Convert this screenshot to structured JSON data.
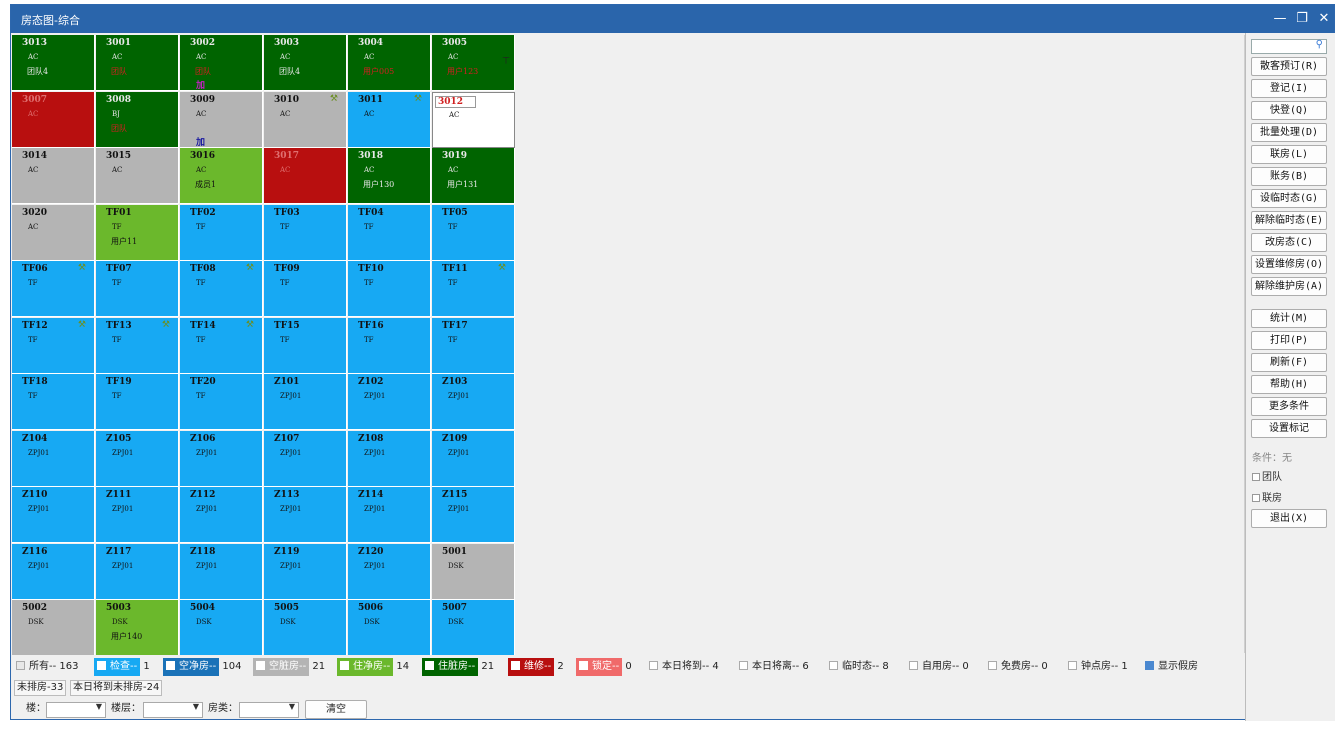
{
  "window": {
    "title": "房态图-综合",
    "minimize": "—",
    "restore": "❐",
    "close": "✕"
  },
  "colors": {
    "empty": "#17a9f3",
    "dirty": "#b4b4b4",
    "occ_clean": "#6bb82c",
    "occ_dirty": "#006400",
    "repair": "#b80f0f",
    "locked": "#f06a6a",
    "titlebar": "#2a65ab"
  },
  "rooms": [
    {
      "num": "3013",
      "type": "AC",
      "guest": "团队4",
      "status": "occ-dirty"
    },
    {
      "num": "3001",
      "type": "AC",
      "guest": "团队",
      "status": "occ-dirty",
      "red": true
    },
    {
      "num": "3002",
      "type": "AC",
      "guest": "团队",
      "status": "occ-dirty",
      "red": true,
      "mark": "加",
      "markColor": "#c020c0"
    },
    {
      "num": "3003",
      "type": "AC",
      "guest": "团队4",
      "status": "occ-dirty"
    },
    {
      "num": "3004",
      "type": "AC",
      "guest": "用户005",
      "status": "occ-dirty",
      "red": true
    },
    {
      "num": "3005",
      "type": "AC",
      "guest": "用户123",
      "status": "occ-dirty",
      "red": true,
      "ext": "ㄒ"
    },
    {
      "num": "3007",
      "type": "AC",
      "guest": "",
      "status": "repair"
    },
    {
      "num": "3008",
      "type": "BJ",
      "guest": "团队",
      "status": "occ-dirty",
      "red": true
    },
    {
      "num": "3009",
      "type": "AC",
      "guest": "",
      "status": "dirty",
      "mark": "加",
      "markColor": "#1a1aa0"
    },
    {
      "num": "3010",
      "type": "AC",
      "guest": "",
      "status": "dirty",
      "tool": true
    },
    {
      "num": "3011",
      "type": "AC",
      "guest": "",
      "status": "empty",
      "tool": true
    },
    {
      "num": "3012",
      "type": "AC",
      "guest": "",
      "status": "white"
    },
    {
      "num": "3014",
      "type": "AC",
      "guest": "",
      "status": "dirty"
    },
    {
      "num": "3015",
      "type": "AC",
      "guest": "",
      "status": "dirty"
    },
    {
      "num": "3016",
      "type": "AC",
      "guest": "成员1",
      "status": "occ-clean"
    },
    {
      "num": "3017",
      "type": "AC",
      "guest": "",
      "status": "repair"
    },
    {
      "num": "3018",
      "type": "AC",
      "guest": "用户130",
      "status": "occ-dirty"
    },
    {
      "num": "3019",
      "type": "AC",
      "guest": "用户131",
      "status": "occ-dirty"
    },
    {
      "num": "3020",
      "type": "AC",
      "guest": "",
      "status": "dirty"
    },
    {
      "num": "TF01",
      "type": "TF",
      "guest": "用户11",
      "status": "occ-clean"
    },
    {
      "num": "TF02",
      "type": "TF",
      "guest": "",
      "status": "empty"
    },
    {
      "num": "TF03",
      "type": "TF",
      "guest": "",
      "status": "empty"
    },
    {
      "num": "TF04",
      "type": "TF",
      "guest": "",
      "status": "empty"
    },
    {
      "num": "TF05",
      "type": "TF",
      "guest": "",
      "status": "empty"
    },
    {
      "num": "TF06",
      "type": "TF",
      "guest": "",
      "status": "empty",
      "tool": true
    },
    {
      "num": "TF07",
      "type": "TF",
      "guest": "",
      "status": "empty"
    },
    {
      "num": "TF08",
      "type": "TF",
      "guest": "",
      "status": "empty",
      "tool": true
    },
    {
      "num": "TF09",
      "type": "TF",
      "guest": "",
      "status": "empty"
    },
    {
      "num": "TF10",
      "type": "TF",
      "guest": "",
      "status": "empty"
    },
    {
      "num": "TF11",
      "type": "TF",
      "guest": "",
      "status": "empty",
      "tool": true
    },
    {
      "num": "TF12",
      "type": "TF",
      "guest": "",
      "status": "empty",
      "tool": true
    },
    {
      "num": "TF13",
      "type": "TF",
      "guest": "",
      "status": "empty",
      "tool": true
    },
    {
      "num": "TF14",
      "type": "TF",
      "guest": "",
      "status": "empty",
      "tool": true
    },
    {
      "num": "TF15",
      "type": "TF",
      "guest": "",
      "status": "empty"
    },
    {
      "num": "TF16",
      "type": "TF",
      "guest": "",
      "status": "empty"
    },
    {
      "num": "TF17",
      "type": "TF",
      "guest": "",
      "status": "empty"
    },
    {
      "num": "TF18",
      "type": "TF",
      "guest": "",
      "status": "empty"
    },
    {
      "num": "TF19",
      "type": "TF",
      "guest": "",
      "status": "empty"
    },
    {
      "num": "TF20",
      "type": "TF",
      "guest": "",
      "status": "empty"
    },
    {
      "num": "Z101",
      "type": "ZPJ01",
      "guest": "",
      "status": "empty"
    },
    {
      "num": "Z102",
      "type": "ZPJ01",
      "guest": "",
      "status": "empty"
    },
    {
      "num": "Z103",
      "type": "ZPJ01",
      "guest": "",
      "status": "empty"
    },
    {
      "num": "Z104",
      "type": "ZPJ01",
      "guest": "",
      "status": "empty"
    },
    {
      "num": "Z105",
      "type": "ZPJ01",
      "guest": "",
      "status": "empty"
    },
    {
      "num": "Z106",
      "type": "ZPJ01",
      "guest": "",
      "status": "empty"
    },
    {
      "num": "Z107",
      "type": "ZPJ01",
      "guest": "",
      "status": "empty"
    },
    {
      "num": "Z108",
      "type": "ZPJ01",
      "guest": "",
      "status": "empty"
    },
    {
      "num": "Z109",
      "type": "ZPJ01",
      "guest": "",
      "status": "empty"
    },
    {
      "num": "Z110",
      "type": "ZPJ01",
      "guest": "",
      "status": "empty"
    },
    {
      "num": "Z111",
      "type": "ZPJ01",
      "guest": "",
      "status": "empty"
    },
    {
      "num": "Z112",
      "type": "ZPJ01",
      "guest": "",
      "status": "empty"
    },
    {
      "num": "Z113",
      "type": "ZPJ01",
      "guest": "",
      "status": "empty"
    },
    {
      "num": "Z114",
      "type": "ZPJ01",
      "guest": "",
      "status": "empty"
    },
    {
      "num": "Z115",
      "type": "ZPJ01",
      "guest": "",
      "status": "empty"
    },
    {
      "num": "Z116",
      "type": "ZPJ01",
      "guest": "",
      "status": "empty"
    },
    {
      "num": "Z117",
      "type": "ZPJ01",
      "guest": "",
      "status": "empty"
    },
    {
      "num": "Z118",
      "type": "ZPJ01",
      "guest": "",
      "status": "empty"
    },
    {
      "num": "Z119",
      "type": "ZPJ01",
      "guest": "",
      "status": "empty"
    },
    {
      "num": "Z120",
      "type": "ZPJ01",
      "guest": "",
      "status": "empty"
    },
    {
      "num": "5001",
      "type": "DSK",
      "guest": "",
      "status": "dirty"
    },
    {
      "num": "5002",
      "type": "DSK",
      "guest": "",
      "status": "dirty"
    },
    {
      "num": "5003",
      "type": "DSK",
      "guest": "用户140",
      "status": "occ-clean"
    },
    {
      "num": "5004",
      "type": "DSK",
      "guest": "",
      "status": "empty"
    },
    {
      "num": "5005",
      "type": "DSK",
      "guest": "",
      "status": "empty"
    },
    {
      "num": "5006",
      "type": "DSK",
      "guest": "",
      "status": "empty"
    },
    {
      "num": "5007",
      "type": "DSK",
      "guest": "",
      "status": "empty"
    }
  ],
  "sidebar": {
    "search_placeholder": "",
    "buttons": [
      "散客预订(R)",
      "登记(I)",
      "快登(Q)",
      "批量处理(D)",
      "联房(L)",
      "账务(B)",
      "设临时态(G)",
      "解除临时态(E)",
      "改房态(C)",
      "设置维修房(O)",
      "解除维护房(A)"
    ],
    "buttons2": [
      "统计(M)",
      "打印(P)",
      "刷新(F)",
      "帮助(H)",
      "更多条件",
      "设置标记"
    ],
    "condition": "条件：无",
    "check_team": "团队",
    "check_link": "联房",
    "exit": "退出(X)"
  },
  "legend": {
    "all": "所有-- 163",
    "inspect": "检查--",
    "inspect_count": "1",
    "empty_clean": "空净房--",
    "empty_clean_count": "104",
    "empty_dirty": "空脏房--",
    "empty_dirty_count": "21",
    "occ_clean": "住净房--",
    "occ_clean_count": "14",
    "occ_dirty": "住脏房--",
    "occ_dirty_count": "21",
    "repair": "维修--",
    "repair_count": "2",
    "locked": "锁定--",
    "locked_count": "0",
    "arrive_today": "本日将到-- 4",
    "leave_today": "本日将离-- 6",
    "temp_state": "临时态-- 8",
    "self_use": "自用房-- 0",
    "free_room": "免费房-- 0",
    "hourly": "钟点房-- 1",
    "show_fake": "显示假房",
    "unassigned": "未排房-33",
    "arrive_unassigned": "本日将到未排房-24",
    "filter_building": "楼：",
    "filter_floor": "楼层：",
    "filter_type": "房类：",
    "clear": "清空"
  }
}
